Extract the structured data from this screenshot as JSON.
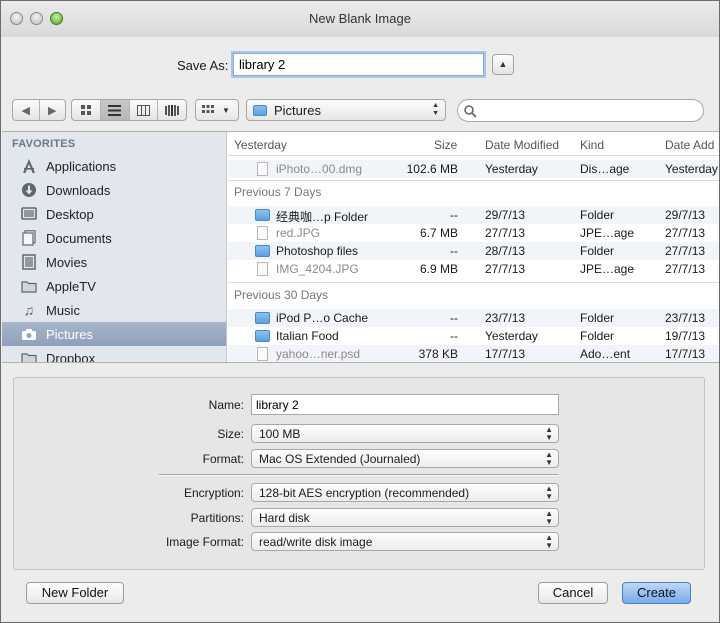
{
  "window": {
    "title": "New Blank Image"
  },
  "save_as": {
    "label": "Save As:",
    "value": "library 2"
  },
  "toolbar": {
    "location": "Pictures",
    "search_placeholder": ""
  },
  "sidebar": {
    "heading": "FAVORITES",
    "items": [
      {
        "label": "Applications",
        "icon": "applications-icon"
      },
      {
        "label": "Downloads",
        "icon": "downloads-icon"
      },
      {
        "label": "Desktop",
        "icon": "desktop-icon"
      },
      {
        "label": "Documents",
        "icon": "documents-icon"
      },
      {
        "label": "Movies",
        "icon": "movies-icon"
      },
      {
        "label": "AppleTV",
        "icon": "folder-icon"
      },
      {
        "label": "Music",
        "icon": "music-icon"
      },
      {
        "label": "Pictures",
        "icon": "camera-icon",
        "selected": true
      },
      {
        "label": "Dropbox",
        "icon": "folder-icon"
      }
    ]
  },
  "columns": {
    "name": "Yesterday",
    "size": "Size",
    "modified": "Date Modified",
    "kind": "Kind",
    "added": "Date Add"
  },
  "groups": {
    "g1": {
      "rows": [
        {
          "name": "iPhoto…00.dmg",
          "size": "102.6 MB",
          "modified": "Yesterday",
          "kind": "Dis…age",
          "added": "Yesterday",
          "type": "file",
          "dim": true
        }
      ]
    },
    "g2": {
      "label": "Previous 7 Days",
      "rows": [
        {
          "name": "经典咖…p Folder",
          "size": "--",
          "modified": "29/7/13",
          "kind": "Folder",
          "added": "29/7/13",
          "type": "folder"
        },
        {
          "name": "red.JPG",
          "size": "6.7 MB",
          "modified": "27/7/13",
          "kind": "JPE…age",
          "added": "27/7/13",
          "type": "file",
          "dim": true
        },
        {
          "name": "Photoshop files",
          "size": "--",
          "modified": "28/7/13",
          "kind": "Folder",
          "added": "27/7/13",
          "type": "folder"
        },
        {
          "name": "IMG_4204.JPG",
          "size": "6.9 MB",
          "modified": "27/7/13",
          "kind": "JPE…age",
          "added": "27/7/13",
          "type": "file",
          "dim": true
        }
      ]
    },
    "g3": {
      "label": "Previous 30 Days",
      "rows": [
        {
          "name": "iPod P…o Cache",
          "size": "--",
          "modified": "23/7/13",
          "kind": "Folder",
          "added": "23/7/13",
          "type": "folder"
        },
        {
          "name": "Italian Food",
          "size": "--",
          "modified": "Yesterday",
          "kind": "Folder",
          "added": "19/7/13",
          "type": "folder"
        },
        {
          "name": "yahoo…ner.psd",
          "size": "378 KB",
          "modified": "17/7/13",
          "kind": "Ado…ent",
          "added": "17/7/13",
          "type": "file",
          "dim": true
        }
      ]
    }
  },
  "options": {
    "name": {
      "label": "Name:",
      "value": "library 2"
    },
    "size": {
      "label": "Size:",
      "value": "100 MB"
    },
    "format": {
      "label": "Format:",
      "value": "Mac OS Extended (Journaled)"
    },
    "encryption": {
      "label": "Encryption:",
      "value": "128-bit AES encryption (recommended)"
    },
    "partitions": {
      "label": "Partitions:",
      "value": "Hard disk"
    },
    "image_format": {
      "label": "Image Format:",
      "value": "read/write disk image"
    }
  },
  "buttons": {
    "new_folder": "New Folder",
    "cancel": "Cancel",
    "create": "Create"
  }
}
